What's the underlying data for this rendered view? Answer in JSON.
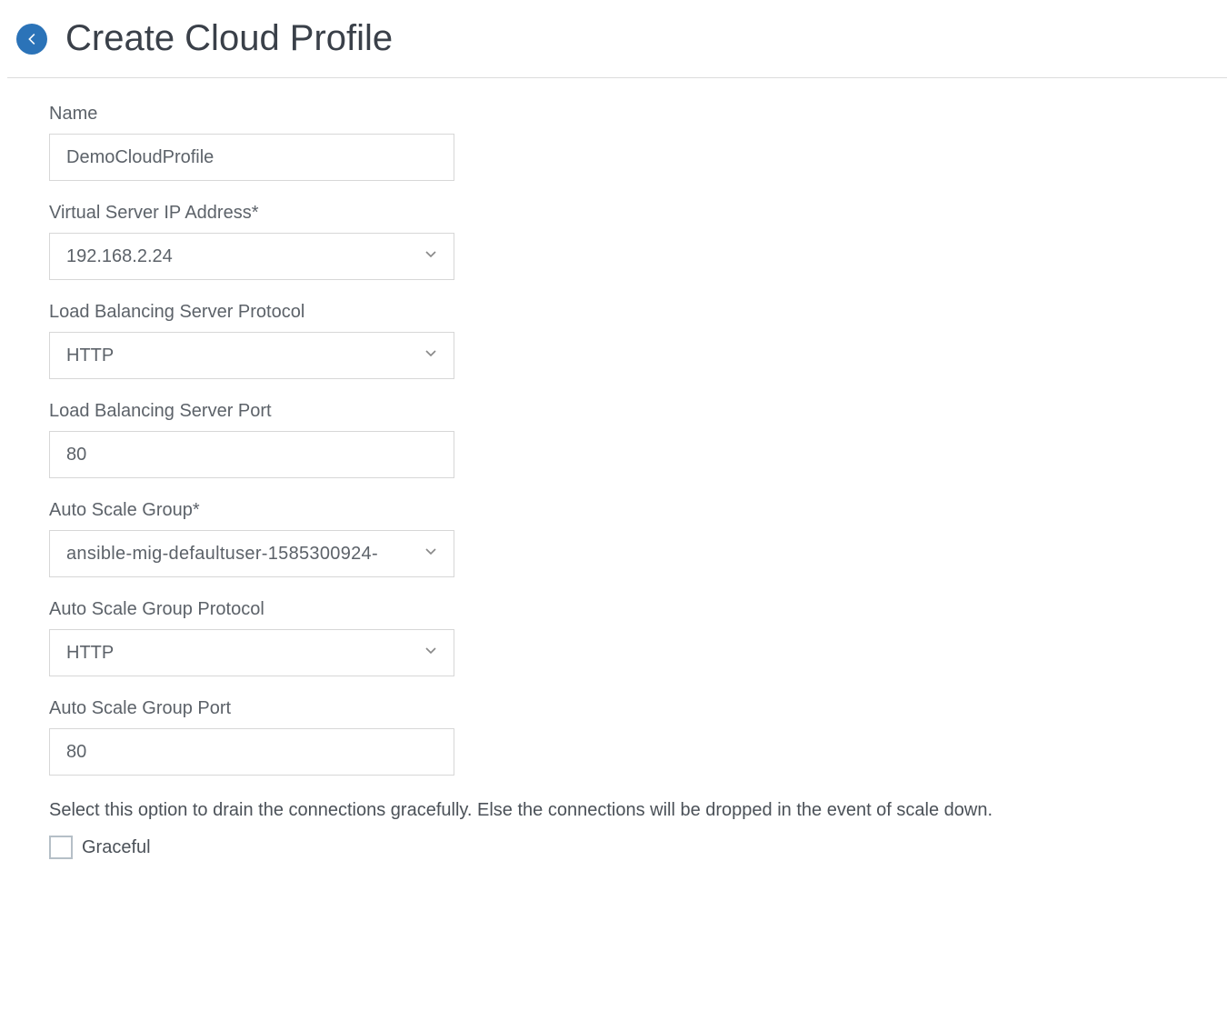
{
  "header": {
    "title": "Create Cloud Profile"
  },
  "form": {
    "name": {
      "label": "Name",
      "value": "DemoCloudProfile"
    },
    "virtual_server_ip": {
      "label": "Virtual Server IP Address*",
      "value": "192.168.2.24"
    },
    "lb_server_protocol": {
      "label": "Load Balancing Server Protocol",
      "value": "HTTP"
    },
    "lb_server_port": {
      "label": "Load Balancing Server Port",
      "value": "80"
    },
    "auto_scale_group": {
      "label": "Auto Scale Group*",
      "value": "ansible-mig-defaultuser-1585300924-"
    },
    "asg_protocol": {
      "label": "Auto Scale Group Protocol",
      "value": "HTTP"
    },
    "asg_port": {
      "label": "Auto Scale Group Port",
      "value": "80"
    },
    "graceful": {
      "help_text": "Select this option to drain the connections gracefully. Else the connections will be dropped in the event of scale down.",
      "label": "Graceful",
      "checked": false
    }
  }
}
